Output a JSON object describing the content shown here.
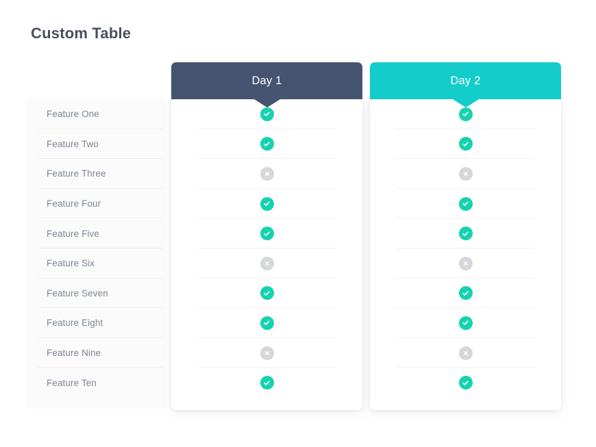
{
  "page": {
    "title": "Custom Table"
  },
  "colors": {
    "day1_header": "#455470",
    "day2_header": "#14ccc9",
    "check_circle": "#14d3ae",
    "cross_circle": "#d6d7da",
    "title_text": "#484f5c",
    "feature_text": "#7d8590",
    "row_divider": "#ececee",
    "page_background": "#ffffff"
  },
  "table": {
    "feature_column": {
      "rows": [
        {
          "label": "Feature One"
        },
        {
          "label": "Feature Two"
        },
        {
          "label": "Feature Three"
        },
        {
          "label": "Feature Four"
        },
        {
          "label": "Feature Five"
        },
        {
          "label": "Feature Six"
        },
        {
          "label": "Feature Seven"
        },
        {
          "label": "Feature Eight"
        },
        {
          "label": "Feature Nine"
        },
        {
          "label": "Feature Ten"
        }
      ]
    },
    "columns": [
      {
        "header": "Day 1",
        "header_color": "#455470",
        "values": [
          {
            "state": "yes",
            "icon": "check-circle-icon"
          },
          {
            "state": "yes",
            "icon": "check-circle-icon"
          },
          {
            "state": "no",
            "icon": "cross-circle-icon"
          },
          {
            "state": "yes",
            "icon": "check-circle-icon"
          },
          {
            "state": "yes",
            "icon": "check-circle-icon"
          },
          {
            "state": "no",
            "icon": "cross-circle-icon"
          },
          {
            "state": "yes",
            "icon": "check-circle-icon"
          },
          {
            "state": "yes",
            "icon": "check-circle-icon"
          },
          {
            "state": "no",
            "icon": "cross-circle-icon"
          },
          {
            "state": "yes",
            "icon": "check-circle-icon"
          }
        ]
      },
      {
        "header": "Day 2",
        "header_color": "#14ccc9",
        "values": [
          {
            "state": "yes",
            "icon": "check-circle-icon"
          },
          {
            "state": "yes",
            "icon": "check-circle-icon"
          },
          {
            "state": "no",
            "icon": "cross-circle-icon"
          },
          {
            "state": "yes",
            "icon": "check-circle-icon"
          },
          {
            "state": "yes",
            "icon": "check-circle-icon"
          },
          {
            "state": "no",
            "icon": "cross-circle-icon"
          },
          {
            "state": "yes",
            "icon": "check-circle-icon"
          },
          {
            "state": "yes",
            "icon": "check-circle-icon"
          },
          {
            "state": "no",
            "icon": "cross-circle-icon"
          },
          {
            "state": "yes",
            "icon": "check-circle-icon"
          }
        ]
      }
    ]
  }
}
